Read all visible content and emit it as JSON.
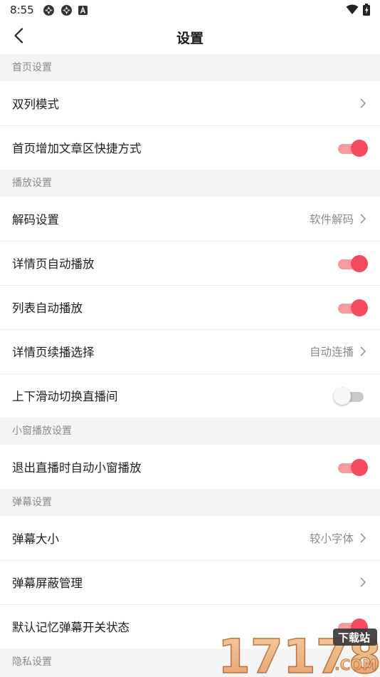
{
  "status_bar": {
    "time": "8:55",
    "icons": [
      "aperture-icon",
      "aperture-icon",
      "a-box-icon",
      "wifi-icon",
      "battery-charging-icon"
    ]
  },
  "header": {
    "title": "设置",
    "back_icon": "chevron-left-icon"
  },
  "sections": [
    {
      "title": "首页设置",
      "rows": [
        {
          "label": "双列模式",
          "value": "",
          "control": "chevron"
        },
        {
          "label": "首页增加文章区快捷方式",
          "value": "",
          "control": "toggle",
          "on": true
        }
      ]
    },
    {
      "title": "播放设置",
      "rows": [
        {
          "label": "解码设置",
          "value": "软件解码",
          "control": "chevron"
        },
        {
          "label": "详情页自动播放",
          "value": "",
          "control": "toggle",
          "on": true
        },
        {
          "label": "列表自动播放",
          "value": "",
          "control": "toggle",
          "on": true
        },
        {
          "label": "详情页续播选择",
          "value": "自动连播",
          "control": "chevron"
        },
        {
          "label": "上下滑动切换直播间",
          "value": "",
          "control": "toggle",
          "on": false
        }
      ]
    },
    {
      "title": "小窗播放设置",
      "rows": [
        {
          "label": "退出直播时自动小窗播放",
          "value": "",
          "control": "toggle",
          "on": true
        }
      ]
    },
    {
      "title": "弹幕设置",
      "rows": [
        {
          "label": "弹幕大小",
          "value": "较小字体",
          "control": "chevron"
        },
        {
          "label": "弹幕屏蔽管理",
          "value": "",
          "control": "chevron"
        },
        {
          "label": "默认记忆弹幕开关状态",
          "value": "",
          "control": "toggle",
          "on": true
        }
      ]
    },
    {
      "title": "隐私设置",
      "rows": []
    }
  ],
  "watermark": {
    "number": "17178",
    "badge": "下载站",
    "suffix": ".COM"
  },
  "colors": {
    "accent": "#f24b5c",
    "accent_track": "#f79aa0",
    "section_bg": "#f4f4f4",
    "section_text": "#8a8a8a",
    "value_text": "#8c8c8c"
  }
}
